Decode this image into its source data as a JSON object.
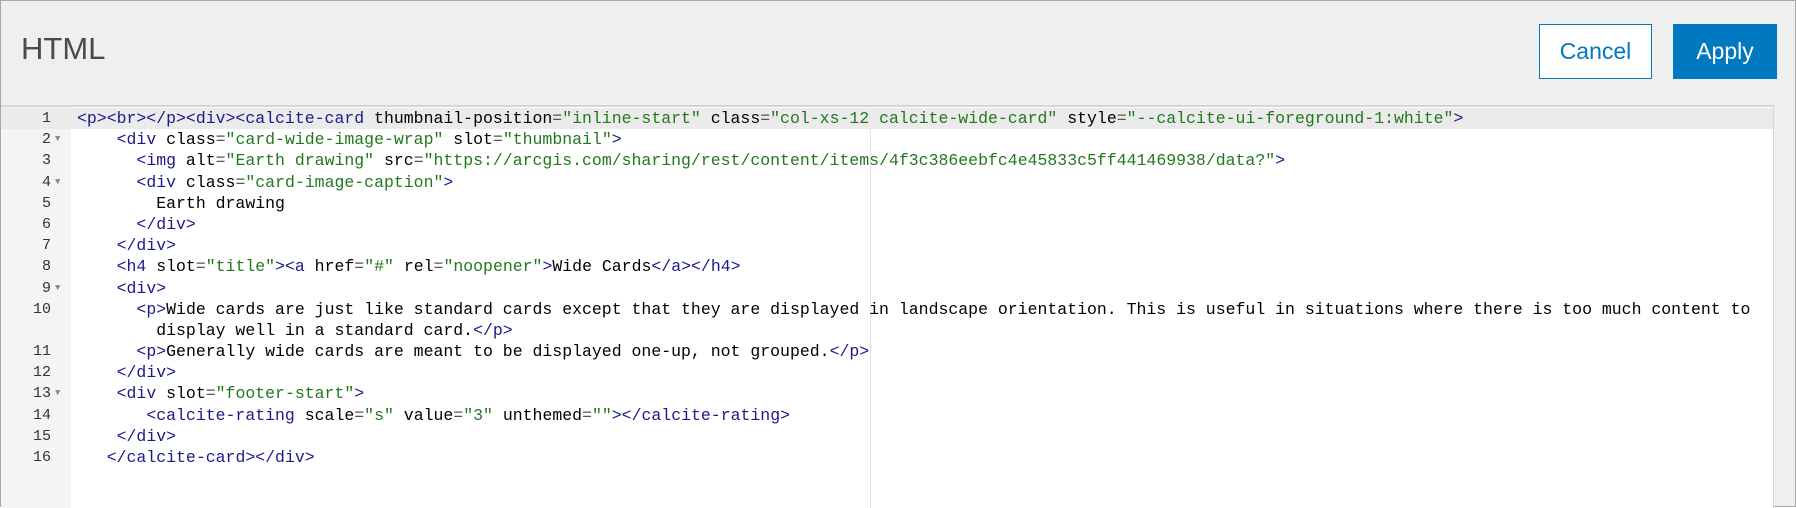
{
  "dialog": {
    "title": "HTML",
    "cancel_label": "Cancel",
    "apply_label": "Apply"
  },
  "colors": {
    "accent": "#0079c1",
    "tag": "#1a1a8c",
    "string": "#23781e"
  },
  "editor": {
    "active_line": 1,
    "rows": [
      {
        "num": "1",
        "fold": false,
        "tokens": [
          [
            "tag",
            "<p><br></p><div><calcite-card"
          ],
          [
            "attr",
            " thumbnail-position"
          ],
          [
            "eq",
            "="
          ],
          [
            "str",
            "\"inline-start\""
          ],
          [
            "attr",
            " class"
          ],
          [
            "eq",
            "="
          ],
          [
            "str",
            "\"col-xs-12 calcite-wide-card\""
          ],
          [
            "attr",
            " style"
          ],
          [
            "eq",
            "="
          ],
          [
            "str",
            "\"--calcite-ui-foreground-1:white\""
          ],
          [
            "tag",
            ">"
          ]
        ]
      },
      {
        "num": "2",
        "fold": true,
        "tokens": [
          [
            "text",
            "    "
          ],
          [
            "tag",
            "<div"
          ],
          [
            "attr",
            " class"
          ],
          [
            "eq",
            "="
          ],
          [
            "str",
            "\"card-wide-image-wrap\""
          ],
          [
            "attr",
            " slot"
          ],
          [
            "eq",
            "="
          ],
          [
            "str",
            "\"thumbnail\""
          ],
          [
            "tag",
            ">"
          ]
        ]
      },
      {
        "num": "3",
        "fold": false,
        "tokens": [
          [
            "text",
            "      "
          ],
          [
            "tag",
            "<img"
          ],
          [
            "attr",
            " alt"
          ],
          [
            "eq",
            "="
          ],
          [
            "str",
            "\"Earth drawing\""
          ],
          [
            "attr",
            " src"
          ],
          [
            "eq",
            "="
          ],
          [
            "str",
            "\"https://arcgis.com/sharing/rest/content/items/4f3c386eebfc4e45833c5ff441469938/data?\""
          ],
          [
            "tag",
            ">"
          ]
        ]
      },
      {
        "num": "4",
        "fold": true,
        "tokens": [
          [
            "text",
            "      "
          ],
          [
            "tag",
            "<div"
          ],
          [
            "attr",
            " class"
          ],
          [
            "eq",
            "="
          ],
          [
            "str",
            "\"card-image-caption\""
          ],
          [
            "tag",
            ">"
          ]
        ]
      },
      {
        "num": "5",
        "fold": false,
        "tokens": [
          [
            "text",
            "        Earth drawing"
          ]
        ]
      },
      {
        "num": "6",
        "fold": false,
        "tokens": [
          [
            "text",
            "      "
          ],
          [
            "tag",
            "</div>"
          ]
        ]
      },
      {
        "num": "7",
        "fold": false,
        "tokens": [
          [
            "text",
            "    "
          ],
          [
            "tag",
            "</div>"
          ]
        ]
      },
      {
        "num": "8",
        "fold": false,
        "tokens": [
          [
            "text",
            "    "
          ],
          [
            "tag",
            "<h4"
          ],
          [
            "attr",
            " slot"
          ],
          [
            "eq",
            "="
          ],
          [
            "str",
            "\"title\""
          ],
          [
            "tag",
            "><a"
          ],
          [
            "attr",
            " href"
          ],
          [
            "eq",
            "="
          ],
          [
            "str",
            "\"#\""
          ],
          [
            "attr",
            " rel"
          ],
          [
            "eq",
            "="
          ],
          [
            "str",
            "\"noopener\""
          ],
          [
            "tag",
            ">"
          ],
          [
            "text",
            "Wide Cards"
          ],
          [
            "tag",
            "</a></h4>"
          ]
        ]
      },
      {
        "num": "9",
        "fold": true,
        "tokens": [
          [
            "text",
            "    "
          ],
          [
            "tag",
            "<div>"
          ]
        ]
      },
      {
        "num": "10",
        "fold": false,
        "tokens": [
          [
            "text",
            "      "
          ],
          [
            "tag",
            "<p>"
          ],
          [
            "text",
            "Wide cards are just like standard cards except that they are displayed in landscape orientation. This is useful in situations where there is too much content to"
          ]
        ]
      },
      {
        "num": "",
        "fold": false,
        "tokens": [
          [
            "text",
            "        display well in a standard card."
          ],
          [
            "tag",
            "</p>"
          ]
        ]
      },
      {
        "num": "11",
        "fold": false,
        "tokens": [
          [
            "text",
            "      "
          ],
          [
            "tag",
            "<p>"
          ],
          [
            "text",
            "Generally wide cards are meant to be displayed one-up, not grouped."
          ],
          [
            "tag",
            "</p>"
          ]
        ]
      },
      {
        "num": "12",
        "fold": false,
        "tokens": [
          [
            "text",
            "    "
          ],
          [
            "tag",
            "</div>"
          ]
        ]
      },
      {
        "num": "13",
        "fold": true,
        "tokens": [
          [
            "text",
            "    "
          ],
          [
            "tag",
            "<div"
          ],
          [
            "attr",
            " slot"
          ],
          [
            "eq",
            "="
          ],
          [
            "str",
            "\"footer-start\""
          ],
          [
            "tag",
            ">"
          ]
        ]
      },
      {
        "num": "14",
        "fold": false,
        "tokens": [
          [
            "text",
            "       "
          ],
          [
            "tag",
            "<calcite-rating"
          ],
          [
            "attr",
            " scale"
          ],
          [
            "eq",
            "="
          ],
          [
            "str",
            "\"s\""
          ],
          [
            "attr",
            " value"
          ],
          [
            "eq",
            "="
          ],
          [
            "str",
            "\"3\""
          ],
          [
            "attr",
            " unthemed"
          ],
          [
            "eq",
            "="
          ],
          [
            "str",
            "\"\""
          ],
          [
            "tag",
            "></calcite-rating>"
          ]
        ]
      },
      {
        "num": "15",
        "fold": false,
        "tokens": [
          [
            "text",
            "    "
          ],
          [
            "tag",
            "</div>"
          ]
        ]
      },
      {
        "num": "16",
        "fold": false,
        "tokens": [
          [
            "text",
            "   "
          ],
          [
            "tag",
            "</calcite-card></div>"
          ]
        ]
      }
    ]
  }
}
